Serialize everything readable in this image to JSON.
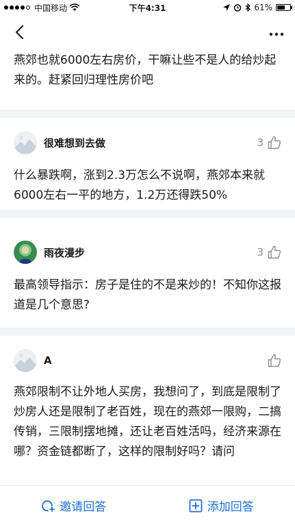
{
  "status_bar": {
    "carrier": "中国移动",
    "time": "下午4:31",
    "battery": "61%",
    "battery_level": 0.61
  },
  "top_excerpt": {
    "text": "燕郊也就6000左右房价，干嘛让些不是人的给炒起来的。赶紧回归理性房价吧"
  },
  "answers": [
    {
      "author": "很难想到去做",
      "votes": "3",
      "text": "什么暴跌啊，涨到2.3万怎么不说啊，燕郊本来就6000左右一平的地方，1.2万还得跌50%"
    },
    {
      "author": "雨夜漫步",
      "votes": "3",
      "text": "最高领导指示：房子是住的不是来炒的！不知你这报道是几个意思?"
    },
    {
      "author": "A",
      "votes": "",
      "text": "燕郊限制不让外地人买房，我想问了，到底是限制了炒房人还是限制了老百姓，现在的燕郊一限购，二搞传销，三限制摆地摊，还让老百姓活吗，经济来源在哪？资金链都断了，这样的限制好吗？请问"
    }
  ],
  "bottom_bar": {
    "invite_label": "邀请回答",
    "add_label": "添加回答",
    "accent_color": "#1f6ed4"
  },
  "icons": {
    "back": "chevron-left-icon",
    "more": "more-icon",
    "thumb": "thumb-up-icon",
    "invite": "invite-icon",
    "add": "add-answer-icon"
  }
}
